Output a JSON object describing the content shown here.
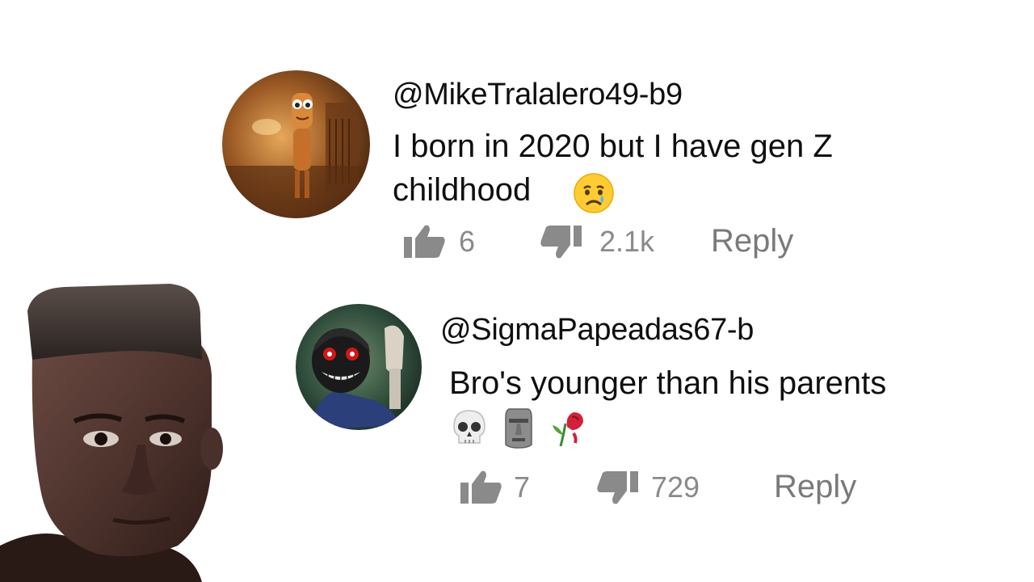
{
  "comments": [
    {
      "handle": "@MikeTralalero49-b9",
      "text_line1": "I born in 2020 but I have gen Z",
      "text_line2": "childhood",
      "emoji": "crying-face",
      "likes": "6",
      "dislikes": "2.1k",
      "reply_label": "Reply"
    },
    {
      "handle": "@SigmaPapeadas67-b",
      "text_line1": "Bro's younger than his parents",
      "emojis": [
        "skull",
        "moai",
        "wilted-rose"
      ],
      "likes": "7",
      "dislikes": "729",
      "reply_label": "Reply"
    }
  ],
  "colors": {
    "text": "#0f0f0f",
    "meta": "#8a8a8a",
    "icon": "#8a8a8a"
  }
}
